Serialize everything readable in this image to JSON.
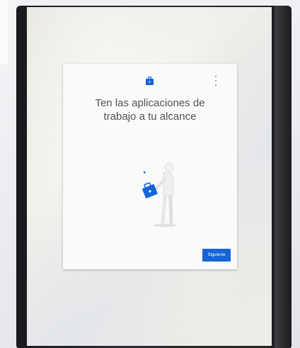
{
  "dialog": {
    "title": "Ten las aplicaciones de\ntrabajo a tu alcance",
    "next_button_label": "Siguiente"
  },
  "icons": {
    "header": "briefcase-icon",
    "menu": "more-vert-icon"
  },
  "colors": {
    "accent": "#1565d8",
    "title_text": "#505355",
    "dialog_background": "#fafafa"
  }
}
